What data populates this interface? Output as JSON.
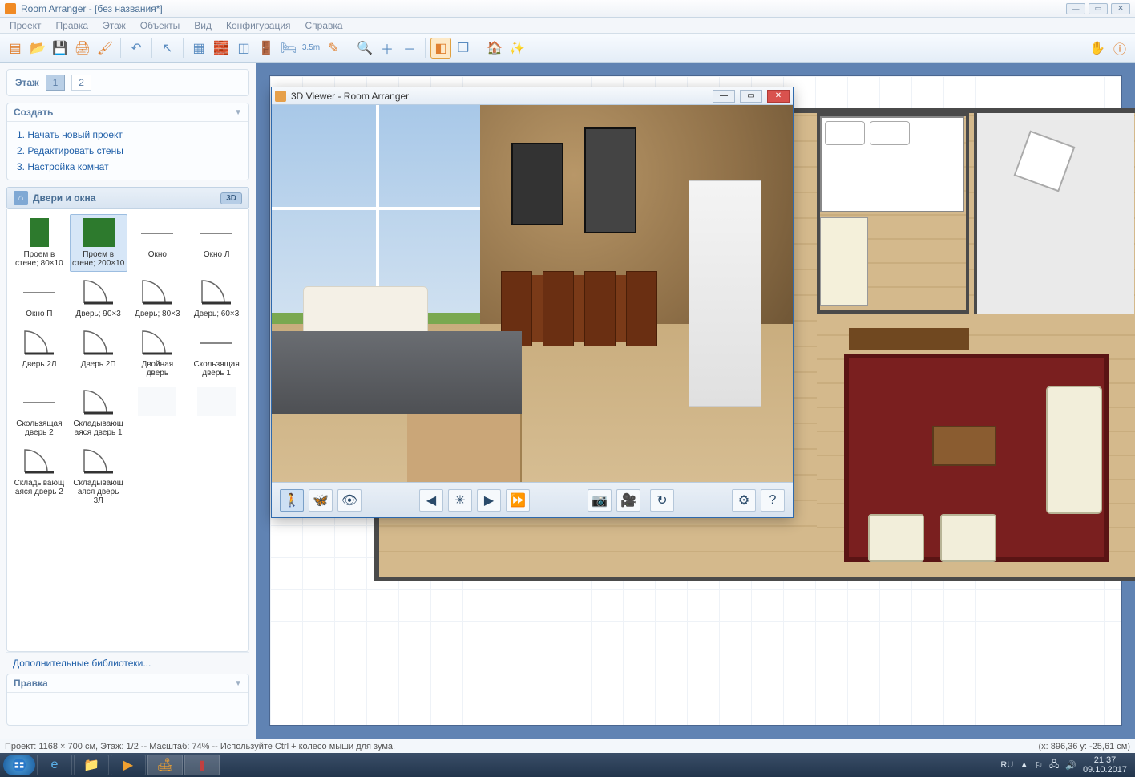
{
  "window": {
    "title": "Room Arranger - [без названия*]"
  },
  "menu": {
    "items": [
      "Проект",
      "Правка",
      "Этаж",
      "Объекты",
      "Вид",
      "Конфигурация",
      "Справка"
    ]
  },
  "sidebar": {
    "floor_label": "Этаж",
    "floors": [
      "1",
      "2"
    ],
    "active_floor": 0,
    "create_header": "Создать",
    "create_items": [
      "1. Начать новый проект",
      "2. Редактировать стены",
      "3. Настройка комнат"
    ],
    "category_title": "Двери и окна",
    "badge_3d": "3D",
    "library": [
      {
        "label": "Проем в стене; 80×10",
        "kind": "wall"
      },
      {
        "label": "Проем в стене; 200×10",
        "kind": "wall2",
        "selected": true
      },
      {
        "label": "Окно",
        "kind": "line"
      },
      {
        "label": "Окно Л",
        "kind": "line"
      },
      {
        "label": "Окно П",
        "kind": "line"
      },
      {
        "label": "Дверь; 90×3",
        "kind": "arc"
      },
      {
        "label": "Дверь; 80×3",
        "kind": "arc"
      },
      {
        "label": "Дверь; 60×3",
        "kind": "arc"
      },
      {
        "label": "Дверь 2Л",
        "kind": "arc"
      },
      {
        "label": "Дверь 2П",
        "kind": "arc"
      },
      {
        "label": "Двойная дверь",
        "kind": "arc"
      },
      {
        "label": "Скользящая дверь 1",
        "kind": "line"
      },
      {
        "label": "Скользящая дверь 2",
        "kind": "line"
      },
      {
        "label": "Складывающаяся дверь 1",
        "kind": "arc"
      },
      {
        "label": "",
        "kind": "empty"
      },
      {
        "label": "",
        "kind": "empty"
      },
      {
        "label": "Складывающаяся дверь 2",
        "kind": "arc"
      },
      {
        "label": "Складывающаяся дверь 3Л",
        "kind": "arc"
      }
    ],
    "more_libraries": "Дополнительные библиотеки...",
    "edit_header": "Правка"
  },
  "viewer3d": {
    "title": "3D Viewer - Room Arranger"
  },
  "status": {
    "left": "Проект: 1168 × 700 см, Этаж: 1/2 -- Масштаб: 74% -- Используйте Ctrl + колесо мыши для зума.",
    "right": "(x: 896,36 y: -25,61 см)"
  },
  "taskbar": {
    "lang": "RU",
    "time": "21:37",
    "date": "09.10.2017"
  },
  "toolbar_icons": [
    "new",
    "open",
    "save",
    "print",
    "paint",
    "sep",
    "undo",
    "sep",
    "pointer",
    "sep",
    "wall",
    "brick",
    "window",
    "door",
    "cabinet",
    "ruler",
    "pencil",
    "sep",
    "zoom",
    "zoom-in",
    "zoom-out",
    "sep",
    "3d",
    "3d-multi",
    "sep",
    "house",
    "sparkle"
  ]
}
